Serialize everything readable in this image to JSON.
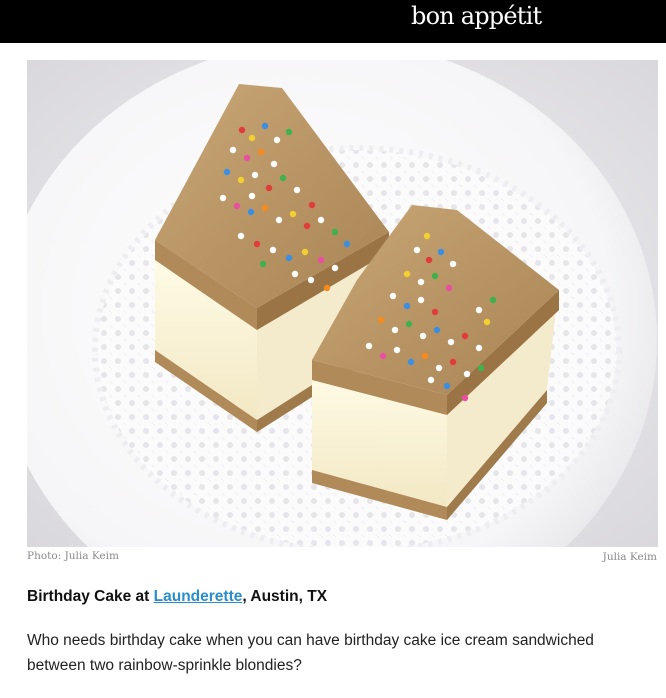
{
  "header": {
    "logo_text": "bon appétit",
    "background": "#000000"
  },
  "hero": {
    "image_alt": "Two birthday cake ice cream sandwiches with rainbow sprinkles on a white doily",
    "caption_left": "Photo: Julia Keim",
    "caption_right": "Julia Keim"
  },
  "article": {
    "title_prefix": "Birthday Cake at ",
    "link_text": "Launderette",
    "title_suffix": ", Austin, TX",
    "description": "Who needs birthday cake when you can have birthday cake ice cream sandwiched between two rainbow-sprinkle blondies?",
    "link_color": "#2a8ec9"
  }
}
